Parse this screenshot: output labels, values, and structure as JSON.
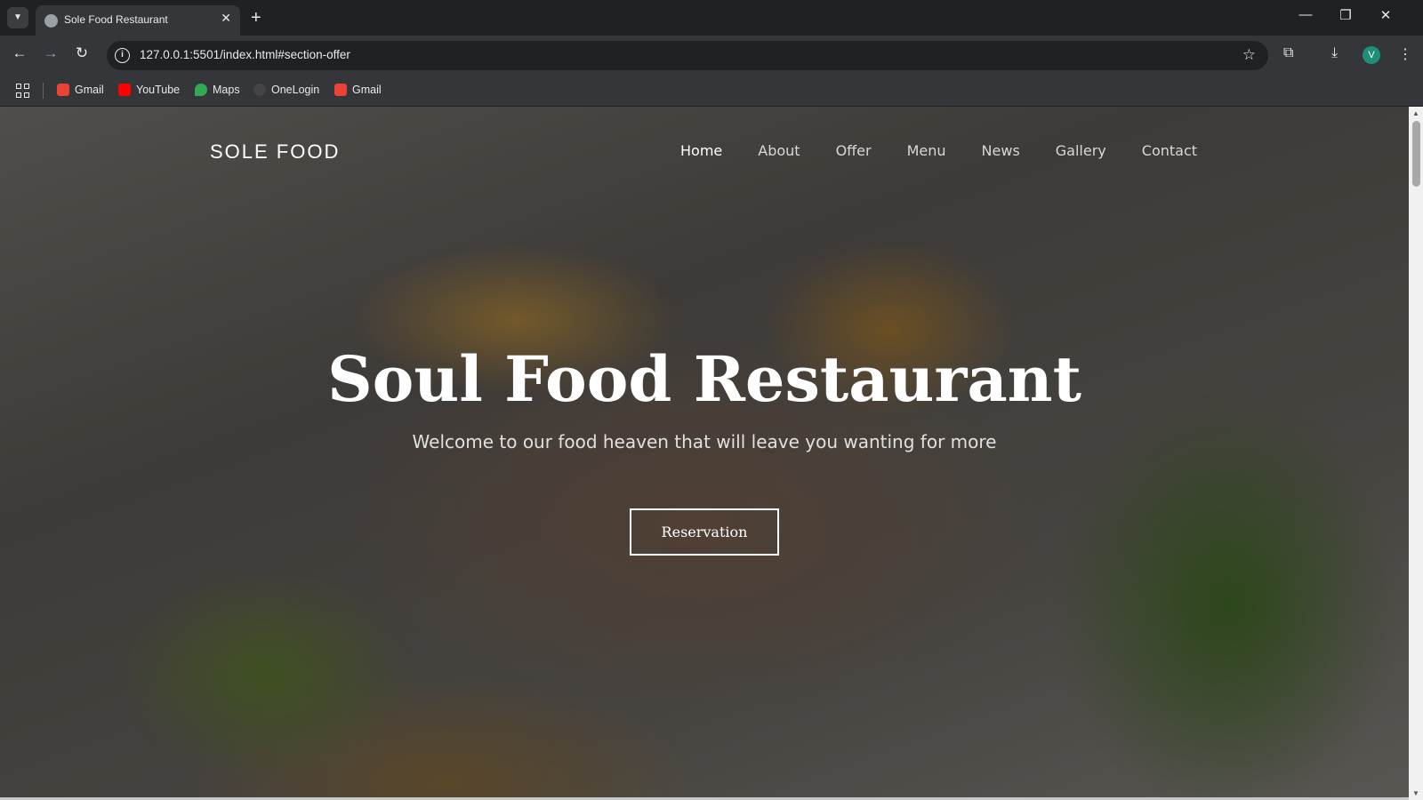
{
  "browser": {
    "tab_title": "Sole Food Restaurant",
    "url": "127.0.0.1:5501/index.html#section-offer",
    "profile_initial": "V",
    "bookmarks": [
      {
        "label": "Gmail",
        "color": "#ea4335"
      },
      {
        "label": "YouTube",
        "color": "#ff0000"
      },
      {
        "label": "Maps",
        "color": "#34a853"
      },
      {
        "label": "OneLogin",
        "color": "#1a1a1a"
      },
      {
        "label": "Gmail",
        "color": "#ea4335"
      }
    ]
  },
  "site": {
    "logo": "SOLE FOOD",
    "nav": [
      "Home",
      "About",
      "Offer",
      "Menu",
      "News",
      "Gallery",
      "Contact"
    ],
    "active_nav": "Home",
    "hero_title": "Soul Food Restaurant",
    "hero_subtitle": "Welcome to our food heaven that will leave you wanting for more",
    "cta_label": "Reservation"
  }
}
